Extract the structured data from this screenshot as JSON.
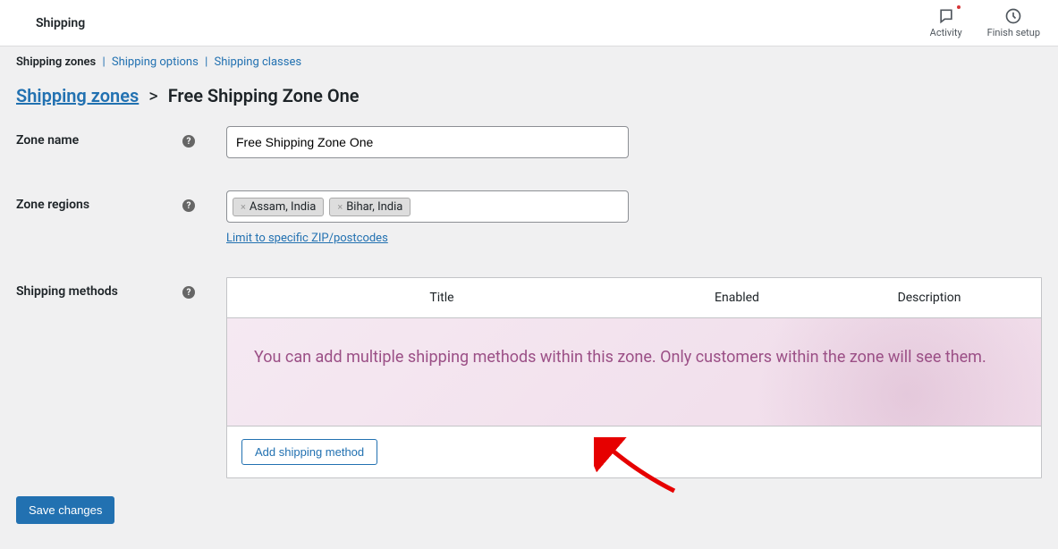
{
  "header": {
    "title": "Shipping",
    "actions": {
      "activity": "Activity",
      "finish_setup": "Finish setup"
    }
  },
  "tabs": {
    "zones": "Shipping zones",
    "options": "Shipping options",
    "classes": "Shipping classes"
  },
  "breadcrumb": {
    "parent": "Shipping zones",
    "current": "Free Shipping Zone One"
  },
  "form": {
    "zone_name": {
      "label": "Zone name",
      "value": "Free Shipping Zone One"
    },
    "zone_regions": {
      "label": "Zone regions",
      "tags": [
        "Assam, India",
        "Bihar, India"
      ],
      "zip_link": "Limit to specific ZIP/postcodes"
    },
    "shipping_methods": {
      "label": "Shipping methods",
      "columns": {
        "title": "Title",
        "enabled": "Enabled",
        "description": "Description"
      },
      "placeholder": "You can add multiple shipping methods within this zone. Only customers within the zone will see them.",
      "add_button": "Add shipping method"
    }
  },
  "buttons": {
    "save": "Save changes"
  }
}
